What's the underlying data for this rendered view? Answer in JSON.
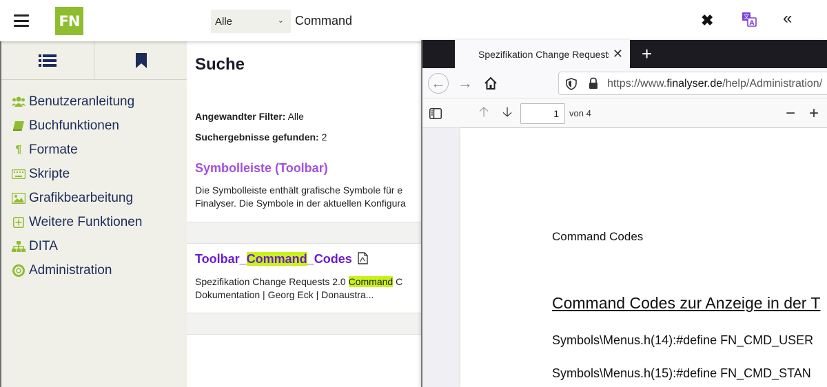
{
  "header": {
    "logo_text": "FN",
    "filter_value": "Alle",
    "search_value": "Command",
    "accent_color": "#8fbd2f"
  },
  "sidebar": {
    "items": [
      {
        "label": "Benutzeranleitung",
        "icon": "users-icon"
      },
      {
        "label": "Buchfunktionen",
        "icon": "book-icon"
      },
      {
        "label": "Formate",
        "icon": "paragraph-icon"
      },
      {
        "label": "Skripte",
        "icon": "keyboard-icon"
      },
      {
        "label": "Grafikbearbeitung",
        "icon": "image-icon"
      },
      {
        "label": "Weitere Funktionen",
        "icon": "plus-square-icon"
      },
      {
        "label": "DITA",
        "icon": "sitemap-icon"
      },
      {
        "label": "Administration",
        "icon": "lifebuoy-icon"
      }
    ]
  },
  "main": {
    "title": "Suche",
    "filter_label": "Angewandter Filter:",
    "filter_value": "Alle",
    "results_label": "Suchergebnisse gefunden:",
    "results_count": "2",
    "results": [
      {
        "title": "Symbolleiste (Toolbar)",
        "color": "#a34fe0",
        "desc_line1": "Die Symbolleiste enthält grafische Symbole für e",
        "desc_line2": "Finalyser. Die Symbole in der aktuellen Konfigura"
      },
      {
        "title_pre": "Toolbar_",
        "title_hl": "Command",
        "title_post": "_Codes",
        "color": "#6a1bd1",
        "desc_pre": "Spezifikation Change Requests 2.0 ",
        "desc_hl": "Command",
        "desc_post": " C",
        "desc_line2": "Dokumentation | Georg Eck | Donaustra..."
      }
    ]
  },
  "browser": {
    "tab_title": "Spezifikation Change Requests",
    "url_prefix": "https://www.",
    "url_domain": "finalyser.de",
    "url_suffix": "/help/Administration/",
    "page_number": "1",
    "page_total": "von 4"
  },
  "pdf": {
    "heading_small": "Command Codes",
    "heading_large": "Command Codes zur Anzeige in der T",
    "line1": "Symbols\\Menus.h(14):#define FN_CMD_USER",
    "line2": "Symbols\\Menus.h(15):#define FN_CMD_STAN"
  }
}
